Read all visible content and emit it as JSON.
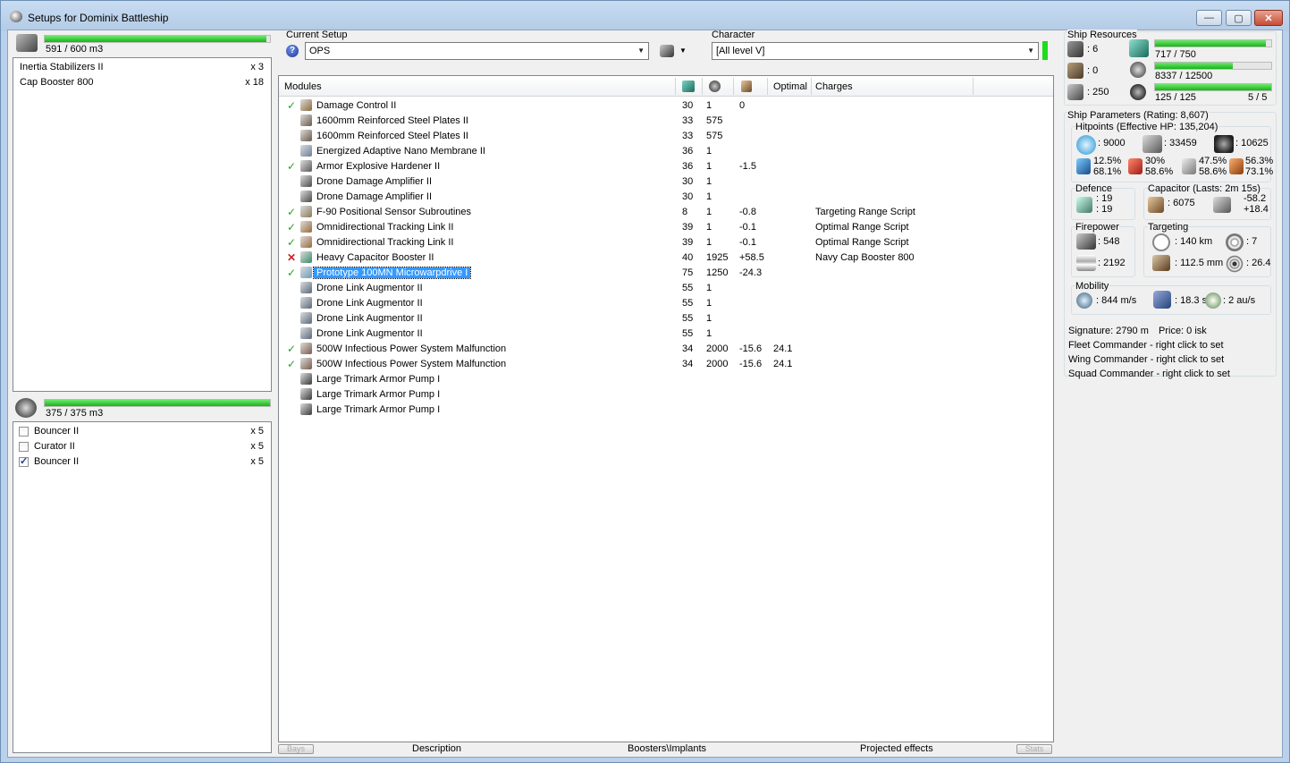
{
  "window": {
    "title": "Setups for Dominix Battleship",
    "minimize": "—",
    "maximize": "▢",
    "close": "✕"
  },
  "cargo": {
    "volume": "591 / 600 m3",
    "fill": 0.985,
    "items": [
      {
        "name": "Inertia Stabilizers II",
        "qty": "x 3"
      },
      {
        "name": "Cap Booster 800",
        "qty": "x 18"
      }
    ]
  },
  "drones": {
    "volume": "375 / 375 m3",
    "fill": 1.0,
    "items": [
      {
        "name": "Bouncer II",
        "qty": "x 5",
        "checked": false
      },
      {
        "name": "Curator II",
        "qty": "x 5",
        "checked": false
      },
      {
        "name": "Bouncer II",
        "qty": "x 5",
        "checked": true
      }
    ]
  },
  "setup": {
    "label": "Current Setup",
    "value": "OPS",
    "help_icon": "?"
  },
  "character": {
    "label": "Character",
    "value": "[All level V]"
  },
  "modules": {
    "headers": {
      "name": "Modules",
      "optimal": "Optimal",
      "charges": "Charges"
    },
    "rows": [
      {
        "state": "on",
        "name": "Damage Control II",
        "cpu": "30",
        "pg": "1",
        "cap": "0",
        "optimal": "",
        "charge": "",
        "color": "#8a6a3a"
      },
      {
        "state": "",
        "name": "1600mm Reinforced Steel Plates II",
        "cpu": "33",
        "pg": "575",
        "cap": "",
        "optimal": "",
        "charge": "",
        "color": "#6a5a4a"
      },
      {
        "state": "",
        "name": "1600mm Reinforced Steel Plates II",
        "cpu": "33",
        "pg": "575",
        "cap": "",
        "optimal": "",
        "charge": "",
        "color": "#6a5a4a"
      },
      {
        "state": "",
        "name": "Energized Adaptive Nano Membrane II",
        "cpu": "36",
        "pg": "1",
        "cap": "",
        "optimal": "",
        "charge": "",
        "color": "#6b7f9a"
      },
      {
        "state": "on",
        "name": "Armor Explosive Hardener II",
        "cpu": "36",
        "pg": "1",
        "cap": "-1.5",
        "optimal": "",
        "charge": "",
        "color": "#5a5a5a"
      },
      {
        "state": "",
        "name": "Drone Damage Amplifier II",
        "cpu": "30",
        "pg": "1",
        "cap": "",
        "optimal": "",
        "charge": "",
        "color": "#4a4a4a"
      },
      {
        "state": "",
        "name": "Drone Damage Amplifier II",
        "cpu": "30",
        "pg": "1",
        "cap": "",
        "optimal": "",
        "charge": "",
        "color": "#4a4a4a"
      },
      {
        "state": "on",
        "name": "F-90 Positional Sensor Subroutines",
        "cpu": "8",
        "pg": "1",
        "cap": "-0.8",
        "optimal": "",
        "charge": "Targeting Range Script",
        "color": "#8a7a5a"
      },
      {
        "state": "on",
        "name": "Omnidirectional Tracking Link II",
        "cpu": "39",
        "pg": "1",
        "cap": "-0.1",
        "optimal": "",
        "charge": "Optimal Range Script",
        "color": "#9a6a3a"
      },
      {
        "state": "on",
        "name": "Omnidirectional Tracking Link II",
        "cpu": "39",
        "pg": "1",
        "cap": "-0.1",
        "optimal": "",
        "charge": "Optimal Range Script",
        "color": "#9a6a3a"
      },
      {
        "state": "off",
        "name": "Heavy Capacitor Booster II",
        "cpu": "40",
        "pg": "1925",
        "cap": "+58.5",
        "optimal": "",
        "charge": "Navy Cap Booster 800",
        "color": "#3a8a6a"
      },
      {
        "state": "on",
        "name": "Prototype 100MN Microwarpdrive I",
        "cpu": "75",
        "pg": "1250",
        "cap": "-24.3",
        "optimal": "",
        "charge": "",
        "color": "#6a9aba",
        "selected": true
      },
      {
        "state": "",
        "name": "Drone Link Augmentor II",
        "cpu": "55",
        "pg": "1",
        "cap": "",
        "optimal": "",
        "charge": "",
        "color": "#5a6a7a"
      },
      {
        "state": "",
        "name": "Drone Link Augmentor II",
        "cpu": "55",
        "pg": "1",
        "cap": "",
        "optimal": "",
        "charge": "",
        "color": "#5a6a7a"
      },
      {
        "state": "",
        "name": "Drone Link Augmentor II",
        "cpu": "55",
        "pg": "1",
        "cap": "",
        "optimal": "",
        "charge": "",
        "color": "#5a6a7a"
      },
      {
        "state": "",
        "name": "Drone Link Augmentor II",
        "cpu": "55",
        "pg": "1",
        "cap": "",
        "optimal": "",
        "charge": "",
        "color": "#5a6a7a"
      },
      {
        "state": "on",
        "name": "500W Infectious Power System Malfunction",
        "cpu": "34",
        "pg": "2000",
        "cap": "-15.6",
        "optimal": "24.1",
        "charge": "",
        "color": "#7a5a4a"
      },
      {
        "state": "on",
        "name": "500W Infectious Power System Malfunction",
        "cpu": "34",
        "pg": "2000",
        "cap": "-15.6",
        "optimal": "24.1",
        "charge": "",
        "color": "#7a5a4a"
      },
      {
        "state": "",
        "name": "Large Trimark Armor Pump I",
        "cpu": "",
        "pg": "",
        "cap": "",
        "optimal": "",
        "charge": "",
        "color": "#3a3a3a"
      },
      {
        "state": "",
        "name": "Large Trimark Armor Pump I",
        "cpu": "",
        "pg": "",
        "cap": "",
        "optimal": "",
        "charge": "",
        "color": "#3a3a3a"
      },
      {
        "state": "",
        "name": "Large Trimark Armor Pump I",
        "cpu": "",
        "pg": "",
        "cap": "",
        "optimal": "",
        "charge": "",
        "color": "#3a3a3a"
      }
    ]
  },
  "bottom_tabs": {
    "bays": "Bays",
    "description": "Description",
    "boosters": "Boosters\\Implants",
    "projected": "Projected effects",
    "stats": "Stats"
  },
  "resources": {
    "title": "Ship Resources",
    "turrets": ": 6",
    "launchers": ": 0",
    "drone_bay": ": 250",
    "cpu": "717 / 750",
    "cpu_fill": 0.956,
    "powergrid": "8337 / 12500",
    "powergrid_fill": 0.667,
    "bandwidth": "125 / 125",
    "bandwidth_fill": 1.0,
    "drones_active": "5 / 5"
  },
  "params": {
    "title": "Ship Parameters (Rating: 8,607)",
    "hitpoints": "Hitpoints (Effective HP: 135,204)",
    "shield_hp": ": 9000",
    "armor_hp": ": 33459",
    "structure_hp": ": 10625",
    "res": [
      {
        "top": "12.5%",
        "bottom": "68.1%"
      },
      {
        "top": "30%",
        "bottom": "58.6%"
      },
      {
        "top": "47.5%",
        "bottom": "58.6%"
      },
      {
        "top": "56.3%",
        "bottom": "73.1%"
      }
    ],
    "defence_title": "Defence",
    "defence_a": ": 19",
    "defence_b": ": 19",
    "cap_title": "Capacitor (Lasts: 2m 15s)",
    "cap_amount": ": 6075",
    "cap_delta_a": "-58.2",
    "cap_delta_b": "+18.4",
    "firepower_title": "Firepower",
    "dps": ": 548",
    "volley": ": 2192",
    "targeting_title": "Targeting",
    "target_range": ": 140 km",
    "max_targets": ": 7",
    "scan_res": ": 112.5 mm",
    "sensor": ": 26.4",
    "mobility_title": "Mobility",
    "speed": ": 844 m/s",
    "align": ": 18.3 s",
    "warp": ": 2 au/s",
    "signature": "Signature: 2790 m",
    "price": "Price: 0 isk",
    "fleet": "Fleet Commander - right click to set",
    "wing": "Wing Commander - right click to set",
    "squad": "Squad Commander - right click to set"
  },
  "colors": {
    "bar_green": "#1db81d",
    "selection": "#3399ff",
    "ok": "#2aa02a",
    "err": "#d02020"
  }
}
